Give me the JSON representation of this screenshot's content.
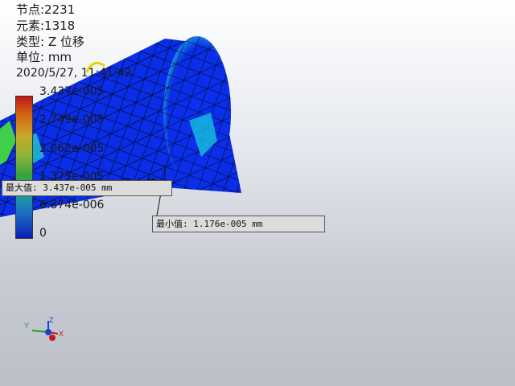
{
  "info": {
    "nodes": "节点:2231",
    "elements": "元素:1318",
    "type": "类型: Z 位移",
    "unit": "单位: mm",
    "date": "2020/5/27, 11:41:42"
  },
  "legend": {
    "ticks": [
      "3.437e-005",
      "2.749e-005",
      "2.062e-005",
      "1.375e-005",
      "6.874e-006",
      "0"
    ]
  },
  "max_marker": {
    "label": "最大值",
    "callout": "最大值: 3.437e-005 mm"
  },
  "min_marker": {
    "callout": "最小值: 1.176e-005 mm"
  },
  "triad": {
    "x": "X",
    "y": "Y",
    "z": "Z"
  },
  "colors": {
    "mesh_blue": "#0022ee",
    "highlight": "#1ad6e0"
  }
}
